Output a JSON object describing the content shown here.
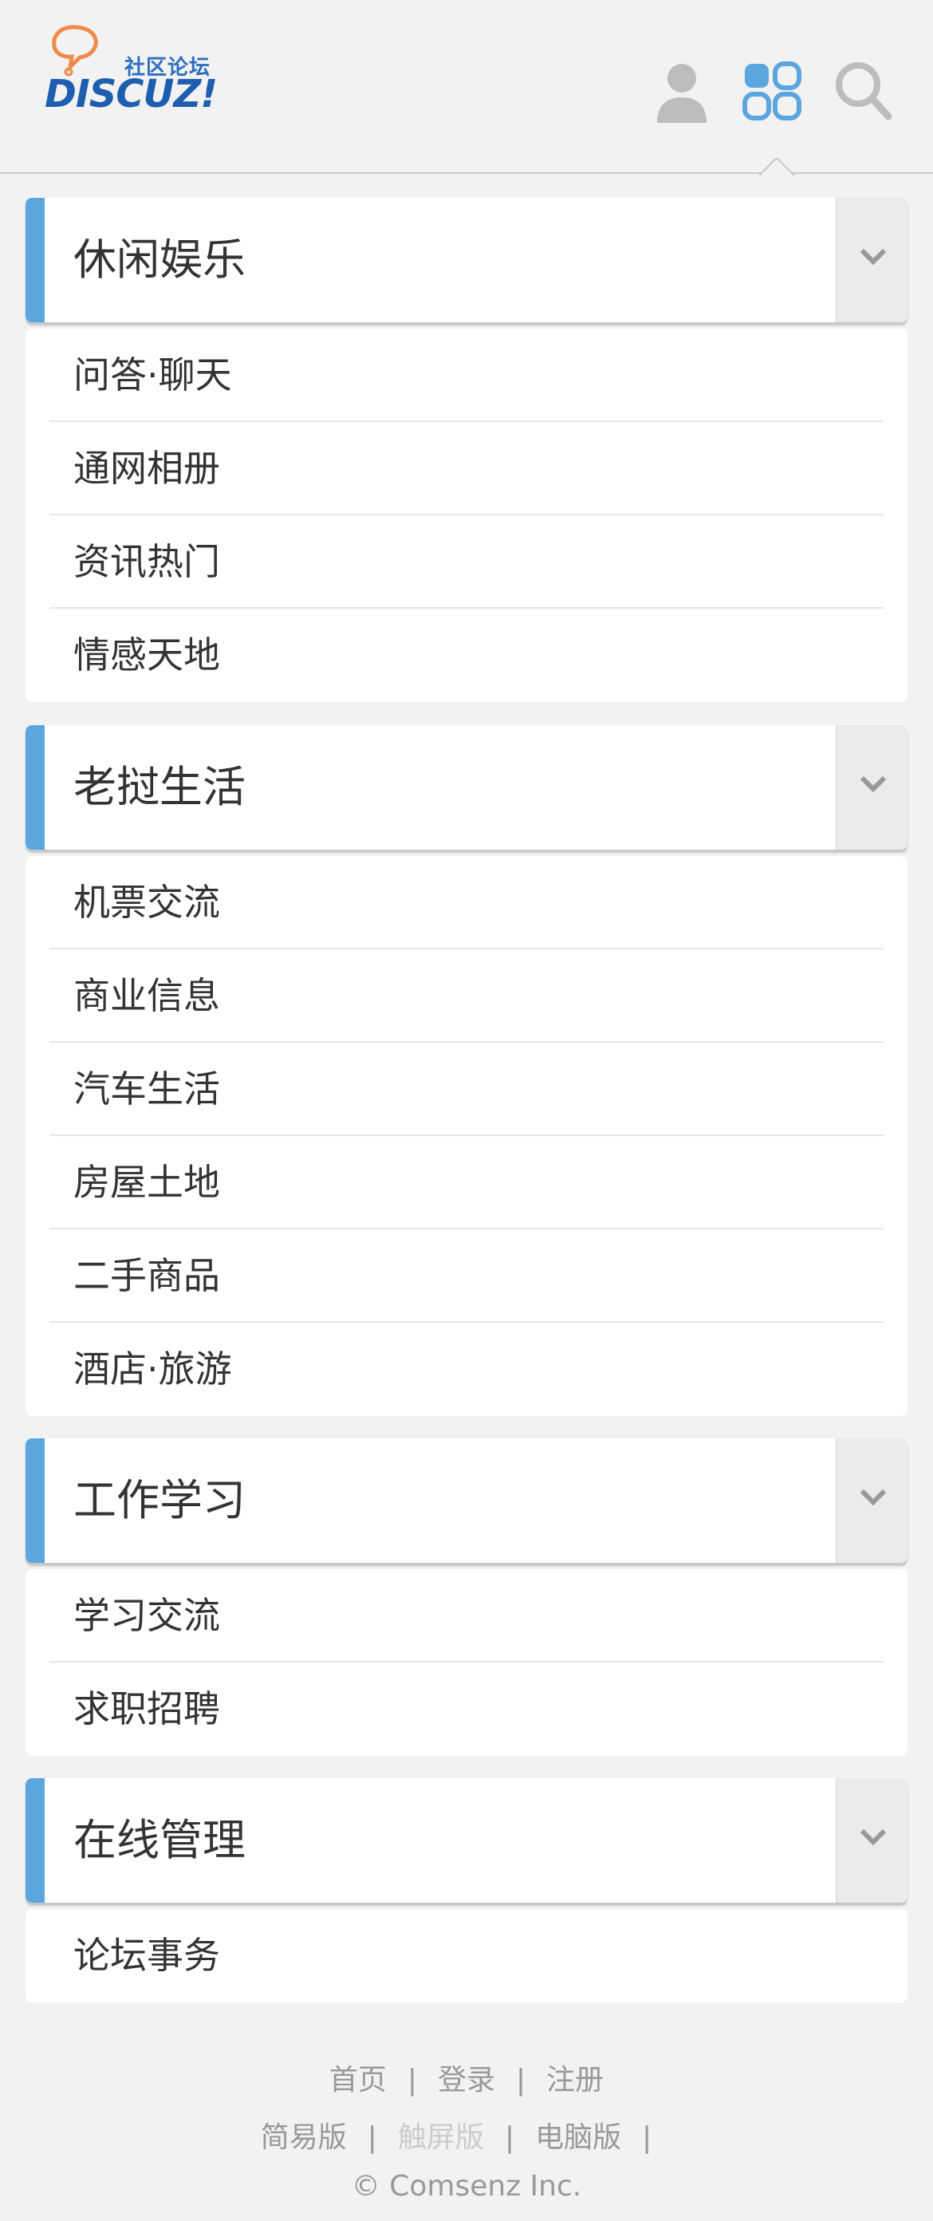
{
  "header": {
    "logo_cn": "社区论坛",
    "logo_en": "DISCUZ!",
    "icons": [
      "user-icon",
      "grid-icon",
      "search-icon"
    ],
    "accent": "#5ba6de"
  },
  "sections": [
    {
      "title": "休闲娱乐",
      "items": [
        "问答·聊天",
        "通网相册",
        "资讯热门",
        "情感天地"
      ]
    },
    {
      "title": "老挝生活",
      "items": [
        "机票交流",
        "商业信息",
        "汽车生活",
        "房屋土地",
        "二手商品",
        "酒店·旅游"
      ]
    },
    {
      "title": "工作学习",
      "items": [
        "学习交流",
        "求职招聘"
      ]
    },
    {
      "title": "在线管理",
      "items": [
        "论坛事务"
      ]
    }
  ],
  "footer": {
    "links1": [
      "首页",
      "登录",
      "注册"
    ],
    "links2": [
      "简易版",
      "触屏版",
      "电脑版"
    ],
    "sep": "|",
    "copyright": "© Comsenz Inc."
  }
}
